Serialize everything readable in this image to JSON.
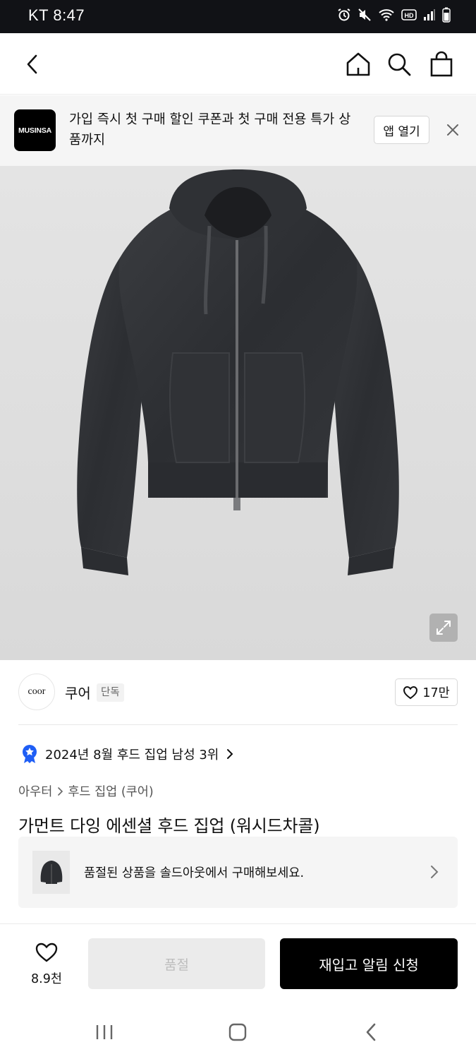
{
  "status_bar": {
    "carrier_time": "KT 8:47"
  },
  "top_nav": {
    "back": "back",
    "home": "home",
    "search": "search",
    "cart": "cart"
  },
  "app_banner": {
    "logo_text": "MUSINSA",
    "message": "가입 즉시 첫 구매 할인 쿠폰과 첫 구매 전용 특가 상품까지",
    "open_button": "앱 열기",
    "close": "close"
  },
  "brand": {
    "logo_text": "coor",
    "name": "쿠어",
    "badge": "단독",
    "likes": "17만"
  },
  "ranking": {
    "text": "2024년 8월 후드 집업 남성 3위"
  },
  "breadcrumb": {
    "category": "아우터",
    "subcategory": "후드 집업 (쿠어)"
  },
  "product": {
    "title": "가먼트 다잉 에센셜 후드 집업 (워시드차콜)"
  },
  "soldout_notice": {
    "text": "품절된 상품을 솔드아웃에서 구매해보세요."
  },
  "actions": {
    "wish_count": "8.9천",
    "soldout_label": "품절",
    "restock_label": "재입고 알림 신청"
  },
  "colors": {
    "accent_blue": "#1f5ef5",
    "primary_black": "#000000",
    "banner_bg": "#f5f5f5"
  }
}
